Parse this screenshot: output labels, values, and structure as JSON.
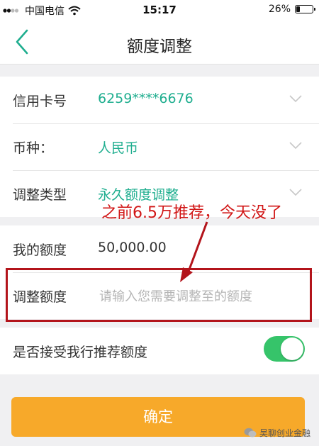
{
  "status_bar": {
    "carrier": "中国电信",
    "time": "15:17",
    "battery": "26%",
    "battery_level": 0.26
  },
  "nav": {
    "title": "额度调整",
    "back_icon": "chevron-left-icon"
  },
  "form": {
    "card_label": "信用卡号",
    "card_value": "6259****6676",
    "currency_label": "币种：",
    "currency_value": "人民币",
    "type_label": "调整类型",
    "type_value": "永久额度调整",
    "current_limit_label": "我的额度",
    "current_limit_value": "50,000.00",
    "adjust_label": "调整额度",
    "adjust_placeholder": "请输入您需要调整至的额度",
    "accept_label": "是否接受我行推荐额度",
    "accept_toggle": true
  },
  "confirm_label": "确定",
  "annotation": "之前6.5万推荐，今天没了",
  "watermark": "吴聊创业金融",
  "colors": {
    "accent_green": "#1fae8f",
    "toggle_green": "#36c46a",
    "button_orange": "#f7a92a",
    "annotation_red": "#d11616",
    "box_red": "#b3141b"
  }
}
